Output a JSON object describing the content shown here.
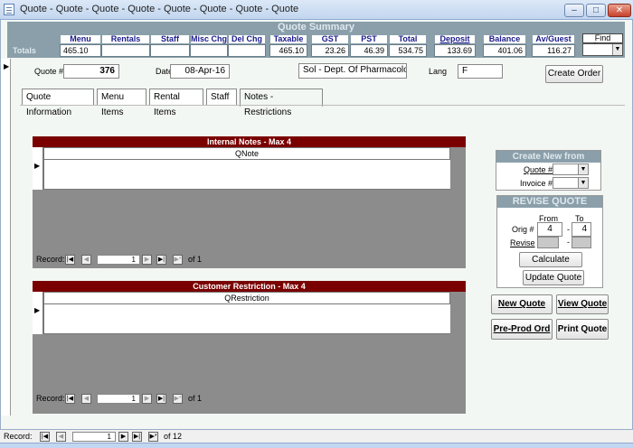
{
  "window": {
    "title": "Quote - Quote - Quote - Quote - Quote - Quote - Quote - Quote",
    "controls": [
      "minimize",
      "maximize",
      "close"
    ]
  },
  "summary": {
    "title": "Quote Summary",
    "totals_label": "Totals",
    "columns": [
      {
        "label": "Menu",
        "value": "465.10"
      },
      {
        "label": "Rentals",
        "value": ""
      },
      {
        "label": "Staff",
        "value": ""
      },
      {
        "label": "Misc Chg",
        "value": ""
      },
      {
        "label": "Del Chg",
        "value": ""
      },
      {
        "label": "Taxable",
        "value": "465.10"
      },
      {
        "label": "GST",
        "value": "23.26"
      },
      {
        "label": "PST",
        "value": "46.39"
      },
      {
        "label": "Total",
        "value": "534.75"
      },
      {
        "label": "Deposit",
        "value": "133.69"
      },
      {
        "label": "Balance",
        "value": "401.06"
      },
      {
        "label": "Av/Guest",
        "value": "116.27"
      }
    ],
    "find_quote_label": "Find Quote"
  },
  "header": {
    "quote_label": "Quote #",
    "quote_value": "376",
    "date_label": "Date",
    "date_value": "08-Apr-16",
    "dept_value": "Sol - Dept. Of Pharmacolog",
    "lang_label": "Lang",
    "lang_value": "F",
    "create_order": "Create Order"
  },
  "tabs": [
    {
      "label": "Quote Information"
    },
    {
      "label": "Menu Items"
    },
    {
      "label": "Rental Items"
    },
    {
      "label": "Staff"
    },
    {
      "label": "Notes - Restrictions"
    }
  ],
  "internal_notes": {
    "title": "Internal Notes - Max 4",
    "column": "QNote",
    "record_label": "Record:",
    "record_value": "1",
    "of_label": "of 1"
  },
  "restrictions": {
    "title": "Customer Restriction - Max 4",
    "column": "QRestriction",
    "record_label": "Record:",
    "record_value": "1",
    "of_label": "of 1"
  },
  "create_new": {
    "title": "Create New from",
    "quote_label": "Quote #",
    "invoice_label": "Invoice #"
  },
  "revise": {
    "title": "REVISE QUOTE",
    "from_label": "From",
    "to_label": "To",
    "orig_label": "Orig #",
    "orig_from": "4",
    "orig_to": "4",
    "revise_label": "Revise",
    "dash": "-",
    "calculate": "Calculate",
    "update": "Update Quote"
  },
  "actions": {
    "new_quote": "New Quote",
    "view_quote": "View Quote",
    "preprod": "Pre-Prod Ord",
    "print_quote": "Print Quote"
  },
  "statusbar": {
    "record_label": "Record:",
    "record_value": "1",
    "of_label": "of 12"
  }
}
